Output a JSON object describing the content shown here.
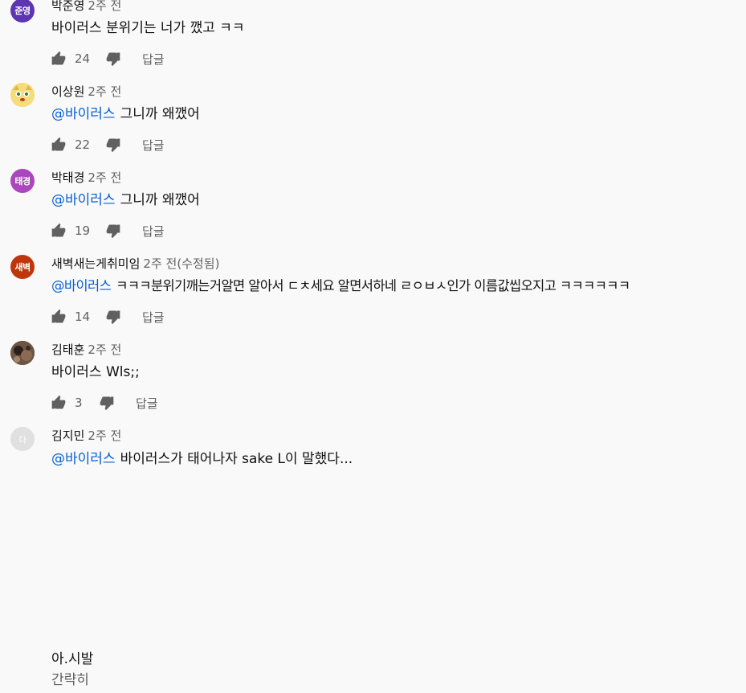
{
  "comments": [
    {
      "author": "박준영",
      "time": "2주 전",
      "mention": "",
      "text": "바이러스 분위기는 너가 깼고 ㅋㅋ",
      "likes": "24",
      "reply_label": "답글",
      "avatar": {
        "initials": "준영",
        "color": "#5e35b1"
      }
    },
    {
      "author": "이상원",
      "time": "2주 전",
      "mention": "@바이러스",
      "text": "그니까 왜깼어",
      "likes": "22",
      "reply_label": "답글",
      "avatar": {
        "initials": "",
        "color": "#f3d46a"
      }
    },
    {
      "author": "박태경",
      "time": "2주 전",
      "mention": "@바이러스",
      "text": "그니까 왜깼어",
      "likes": "19",
      "reply_label": "답글",
      "avatar": {
        "initials": "태경",
        "color": "#ab47bc"
      }
    },
    {
      "author": "새벽새는게취미임",
      "time": "2주 전(수정됨)",
      "mention": "@바이러스",
      "text": "ㅋㅋㅋ분위기깨는거알면 알아서 ㄷㅊ세요 알면서하네 ㄹㅇㅂㅅ인가 이름값씹오지고 ㅋㅋㅋㅋㅋㅋ",
      "likes": "14",
      "reply_label": "답글",
      "avatar": {
        "initials": "새벽",
        "color": "#bf360c"
      }
    },
    {
      "author": "김태훈",
      "time": "2주 전",
      "mention": "",
      "text": "바이러스 Wls;;",
      "likes": "3",
      "reply_label": "답글",
      "avatar": {
        "initials": "",
        "color": "#4e3b2c"
      }
    },
    {
      "author": "김지민",
      "time": "2주 전",
      "mention": "@바이러스",
      "text": "바이러스가 태어나자 sake L이 말했다...",
      "likes": "",
      "reply_label": "",
      "avatar": {
        "initials": "다",
        "color": "#e0e0e0"
      }
    }
  ],
  "footer": {
    "text": "아.시발",
    "more_label": "간략히"
  }
}
